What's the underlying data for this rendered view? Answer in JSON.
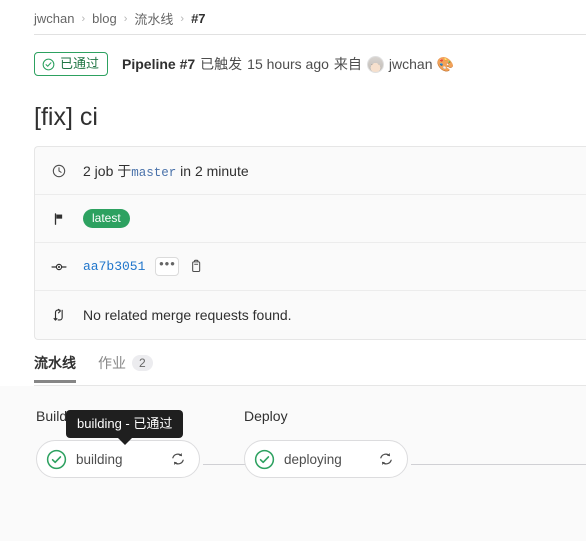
{
  "breadcrumb": {
    "items": [
      {
        "label": "jwchan",
        "current": false
      },
      {
        "label": "blog",
        "current": false
      },
      {
        "label": "流水线",
        "current": false
      },
      {
        "label": "#7",
        "current": true
      }
    ],
    "separator": "›"
  },
  "header": {
    "status_label": "已通过",
    "pipeline_label": "Pipeline #7",
    "triggered_label": "已触发",
    "time_ago": "15 hours ago",
    "by_label": "来自",
    "user_name": "jwchan",
    "user_emoji": "🎨",
    "status_color": "#2da160"
  },
  "title": "[fix] ci",
  "info_card": {
    "rows": [
      {
        "icon": "clock-icon",
        "text_before": "2 job 于",
        "branch": "master",
        "text_after": "in 2 minute"
      },
      {
        "icon": "flag-icon",
        "badge": "latest",
        "badge_color": "#2da160"
      },
      {
        "icon": "commit-icon",
        "sha": "aa7b3051",
        "ellipsis": "•••",
        "copy_icon": "clipboard-icon"
      },
      {
        "icon": "merge-request-icon",
        "text": "No related merge requests found."
      }
    ]
  },
  "tabs": [
    {
      "label": "流水线",
      "active": true,
      "count": null
    },
    {
      "label": "作业",
      "active": false,
      "count": "2"
    }
  ],
  "graph": {
    "stages": [
      {
        "name": "Build",
        "jobs": [
          {
            "name": "building",
            "status": "passed",
            "status_color": "#2da160",
            "action": "retry-icon"
          }
        ]
      },
      {
        "name": "Deploy",
        "jobs": [
          {
            "name": "deploying",
            "status": "passed",
            "status_color": "#2da160",
            "action": "retry-icon"
          }
        ]
      }
    ]
  },
  "tooltip": {
    "text": "building - 已通过"
  }
}
